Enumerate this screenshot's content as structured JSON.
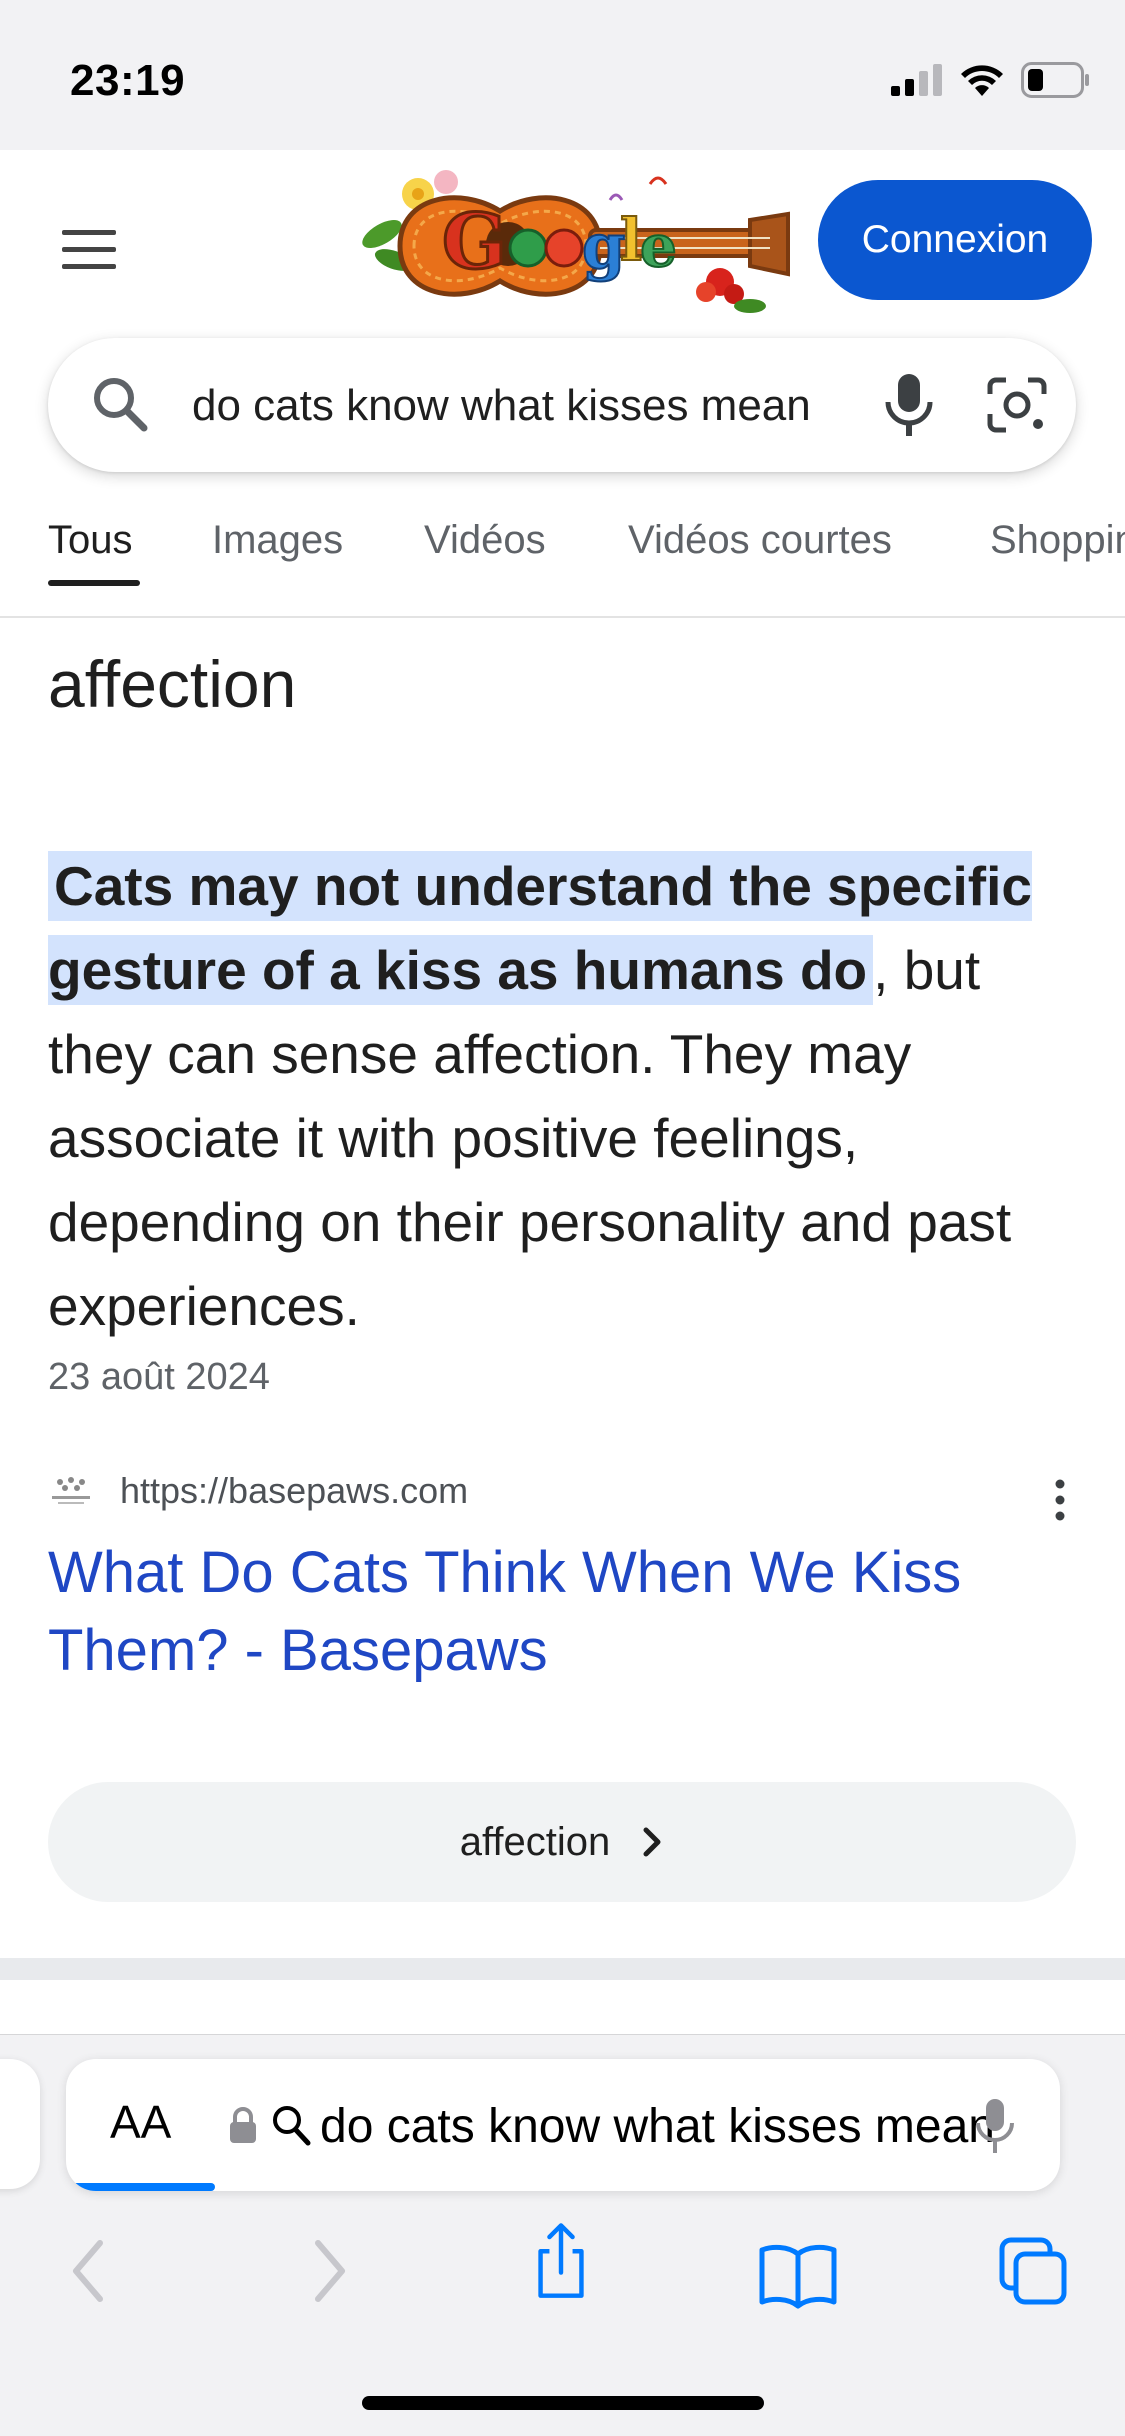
{
  "status_bar": {
    "time": "23:19"
  },
  "header": {
    "signin_label": "Connexion",
    "logo_alt": "Google"
  },
  "search": {
    "query": "do cats know what kisses mean"
  },
  "tabs": [
    {
      "label": "Tous",
      "active": true
    },
    {
      "label": "Images",
      "active": false
    },
    {
      "label": "Vidéos",
      "active": false
    },
    {
      "label": "Vidéos courtes",
      "active": false
    },
    {
      "label": "Shopping",
      "active": false
    }
  ],
  "result": {
    "heading_fragment": "affection",
    "snippet_highlight": "Cats may not understand the specific gesture of a kiss as humans do",
    "snippet_rest": ", but they can sense affection. They may associate it with positive feelings, depending on their personality and past experiences.",
    "date": "23 août 2024",
    "source_url": "https://basepaws.com",
    "title": "What Do Cats Think When We Kiss Them? - Basepaws",
    "chip_label": "affection"
  },
  "safari": {
    "aa_label": "AA",
    "address_text": "do cats know what kisses mean",
    "load_progress": 0.15
  },
  "colors": {
    "signin_bg": "#0b57d0",
    "link": "#1f47c4",
    "highlight": "#d3e3fd",
    "safari_blue": "#007aff"
  },
  "icons": [
    "menu-icon",
    "search-icon",
    "mic-icon",
    "google-lens-icon",
    "more-vert-icon",
    "chevron-right-icon",
    "lock-icon",
    "back-icon",
    "forward-icon",
    "share-icon",
    "bookmarks-icon",
    "tabs-icon"
  ]
}
